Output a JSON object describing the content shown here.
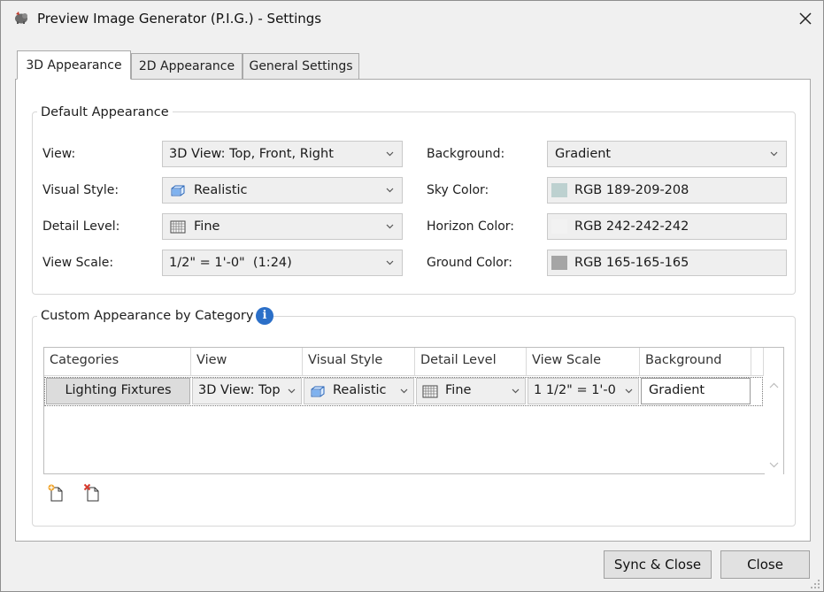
{
  "window": {
    "title": "Preview Image Generator (P.I.G.) - Settings",
    "app_icon": "pig-app-icon",
    "close_icon": "close-icon"
  },
  "tabs": [
    {
      "label": "3D Appearance",
      "active": true
    },
    {
      "label": "2D Appearance",
      "active": false
    },
    {
      "label": "General Settings",
      "active": false
    }
  ],
  "default_appearance": {
    "title": "Default Appearance",
    "view_label": "View:",
    "view_value": "3D View: Top, Front, Right",
    "visual_style_label": "Visual Style:",
    "visual_style_value": "Realistic",
    "visual_style_icon": "realistic-style-icon",
    "detail_level_label": "Detail Level:",
    "detail_level_value": "Fine",
    "detail_level_icon": "fine-detail-icon",
    "view_scale_label": "View Scale:",
    "view_scale_value": "1/2\" = 1'-0\"  (1:24)",
    "background_label": "Background:",
    "background_value": "Gradient",
    "sky_color_label": "Sky Color:",
    "sky_color_value": "RGB 189-209-208",
    "sky_color_hex": "#bdd1d0",
    "horizon_color_label": "Horizon Color:",
    "horizon_color_value": "RGB 242-242-242",
    "horizon_color_hex": "#f2f2f2",
    "ground_color_label": "Ground Color:",
    "ground_color_value": "RGB 165-165-165",
    "ground_color_hex": "#a5a5a5"
  },
  "custom_appearance": {
    "title": "Custom Appearance by Category",
    "info_icon": "info-icon",
    "info_glyph": "i",
    "columns": [
      "Categories",
      "View",
      "Visual Style",
      "Detail Level",
      "View Scale",
      "Background"
    ],
    "rows": [
      {
        "category": "Lighting Fixtures",
        "view": "3D View: Top",
        "visual_style": "Realistic",
        "detail_level": "Fine",
        "view_scale": "1 1/2\" = 1'-0",
        "background": "Gradient"
      }
    ],
    "add_icon": "add-category-icon",
    "remove_icon": "remove-category-icon"
  },
  "footer": {
    "sync_close_label": "Sync & Close",
    "close_label": "Close"
  },
  "colors": {
    "accent": "#2b6fc8",
    "remove_red": "#d83b2e",
    "add_orange": "#f0a020"
  }
}
